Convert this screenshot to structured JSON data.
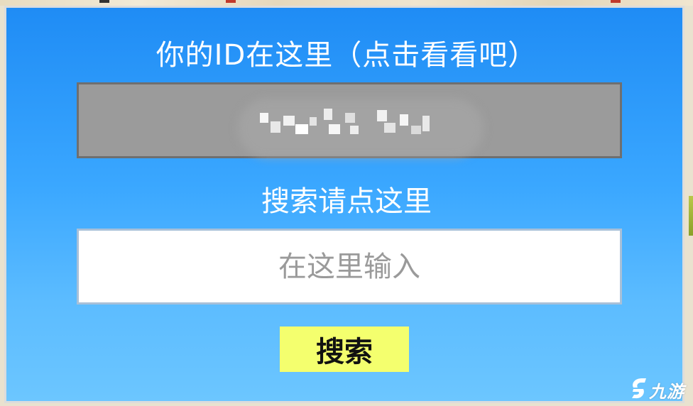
{
  "id_section": {
    "title": "你的ID在这里（点击看看吧）",
    "id_value": ""
  },
  "search_section": {
    "label": "搜索请点这里",
    "input_placeholder": "在这里输入",
    "input_value": "",
    "button_label": "搜索"
  },
  "watermark": {
    "brand_text": "九游",
    "icon": "jiuyou-logo-icon"
  },
  "colors": {
    "background_top": "#1f8cf5",
    "background_bottom": "#6cc6ff",
    "id_box": "#9b9b9b",
    "button": "#f4ff6e",
    "text": "#ffffff"
  }
}
